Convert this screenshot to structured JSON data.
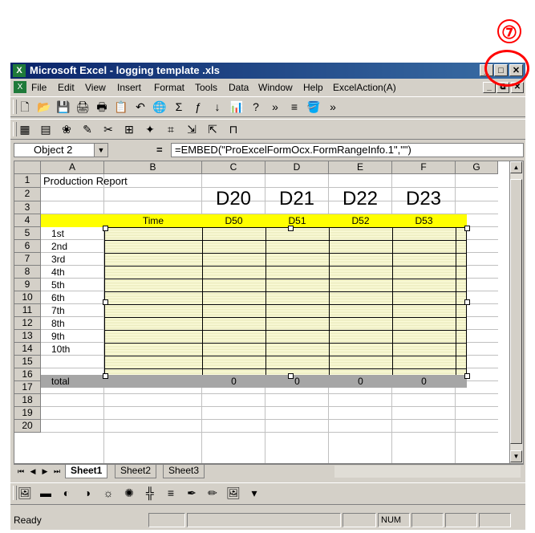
{
  "callout": {
    "number": "⑦"
  },
  "window": {
    "title": "Microsoft Excel - logging template .xls",
    "app_icon": "excel-icon",
    "controls": [
      "_",
      "□",
      "✕"
    ]
  },
  "menu": {
    "items": [
      "File",
      "Edit",
      "View",
      "Insert",
      "Format",
      "Tools",
      "Data",
      "Window",
      "Help",
      "ExcelAction(A)"
    ],
    "doc_controls": [
      "_",
      "⧉",
      "✕"
    ]
  },
  "toolbar1": {
    "icons": [
      "new-icon",
      "open-icon",
      "save-icon",
      "print-icon",
      "print-preview-icon",
      "paste-icon",
      "undo-icon",
      "hyperlink-icon",
      "autosum-icon",
      "function-icon",
      "sort-icon",
      "chart-icon",
      "help-icon",
      "more-icon",
      "align-icon",
      "fill-color-icon",
      "overflow-icon"
    ],
    "glyphs": [
      "🗋",
      "📂",
      "💾",
      "🖨",
      "🖶",
      "📋",
      "↶",
      "🌐",
      "Σ",
      "ƒ",
      "↓",
      "📊",
      "?",
      "»",
      "≡",
      "🪣",
      "»"
    ]
  },
  "toolbar2": {
    "icons": [
      "toolbar2-icon-1",
      "toolbar2-icon-2",
      "toolbar2-icon-3",
      "toolbar2-icon-4",
      "toolbar2-icon-5",
      "toolbar2-icon-6",
      "toolbar2-icon-7",
      "toolbar2-icon-8",
      "toolbar2-icon-9",
      "toolbar2-icon-10",
      "toolbar2-icon-11"
    ],
    "glyphs": [
      "▦",
      "▤",
      "❀",
      "✎",
      "✂",
      "⊞",
      "✦",
      "⌗",
      "⇲",
      "⇱",
      "⊓"
    ]
  },
  "formula_bar": {
    "name_box": "Object 2",
    "equals": "=",
    "formula": "=EMBED(\"ProExcelFormOcx.FormRangeInfo.1\",\"\")"
  },
  "columns": [
    "A",
    "B",
    "C",
    "D",
    "E",
    "F",
    "G"
  ],
  "rows": [
    "1",
    "2",
    "3",
    "4",
    "5",
    "6",
    "7",
    "8",
    "9",
    "10",
    "11",
    "12",
    "13",
    "14",
    "15",
    "16",
    "17",
    "18",
    "19",
    "20"
  ],
  "cells": {
    "title": "Production Report",
    "device_labels": [
      "D20",
      "D21",
      "D22",
      "D23"
    ],
    "time_header": "Time",
    "column_headers": [
      "D50",
      "D51",
      "D52",
      "D53"
    ],
    "row_labels": [
      "1st",
      "2nd",
      "3rd",
      "4th",
      "5th",
      "6th",
      "7th",
      "8th",
      "9th",
      "10th"
    ],
    "total_label": "total",
    "totals": [
      "0",
      "0",
      "0",
      "0"
    ]
  },
  "tabs": {
    "nav": [
      "⏮",
      "◀",
      "▶",
      "⏭"
    ],
    "sheets": [
      "Sheet1",
      "Sheet2",
      "Sheet3"
    ]
  },
  "drawing_toolbar": {
    "icons": [
      "draw-icon-1",
      "draw-icon-2",
      "draw-icon-3",
      "draw-icon-4",
      "draw-icon-5",
      "draw-icon-6",
      "draw-icon-7",
      "draw-icon-8",
      "draw-icon-9",
      "draw-icon-10",
      "draw-icon-11",
      "draw-icon-12"
    ],
    "glyphs": [
      "🖼",
      "▬",
      "◐",
      "◑",
      "☼",
      "✺",
      "╬",
      "≡",
      "✒",
      "✏",
      "🖼",
      "▾"
    ]
  },
  "status": {
    "text": "Ready",
    "num": "NUM"
  }
}
